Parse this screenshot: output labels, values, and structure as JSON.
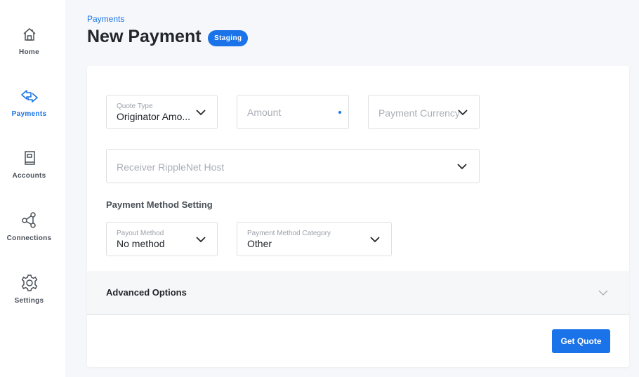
{
  "sidebar": {
    "items": [
      {
        "label": "Home",
        "icon": "home-icon",
        "active": false
      },
      {
        "label": "Payments",
        "icon": "payments-arrows-icon",
        "active": true
      },
      {
        "label": "Accounts",
        "icon": "accounts-book-icon",
        "active": false
      },
      {
        "label": "Connections",
        "icon": "connections-share-icon",
        "active": false
      },
      {
        "label": "Settings",
        "icon": "settings-gear-icon",
        "active": false
      }
    ]
  },
  "header": {
    "breadcrumb": "Payments",
    "title": "New Payment",
    "badge": "Staging"
  },
  "form": {
    "quote_type": {
      "label": "Quote Type",
      "value": "Originator Amo..."
    },
    "amount": {
      "placeholder": "Amount"
    },
    "payment_currency": {
      "placeholder": "Payment Currency"
    },
    "receiver_host": {
      "placeholder": "Receiver RippleNet Host"
    },
    "payment_method_section": "Payment Method Setting",
    "payout_method": {
      "label": "Payout Method",
      "value": "No method"
    },
    "payment_method_category": {
      "label": "Payment Method Category",
      "value": "Other"
    },
    "advanced_options": "Advanced Options",
    "get_quote": "Get Quote"
  },
  "colors": {
    "accent": "#1a73e8",
    "background": "#f5f7fa"
  }
}
